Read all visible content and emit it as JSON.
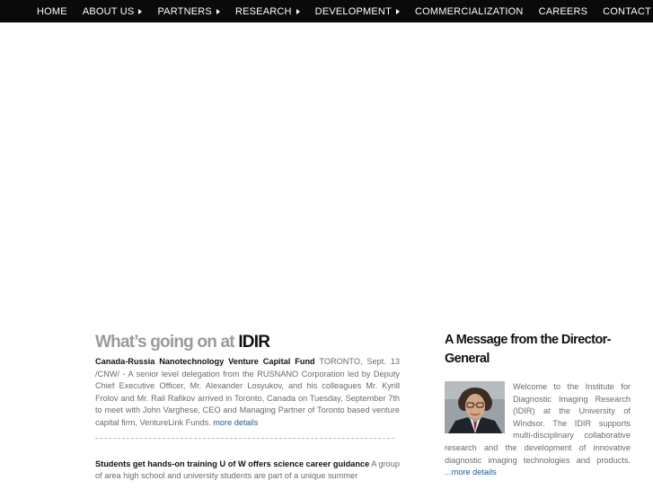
{
  "nav": {
    "items": [
      {
        "label": "HOME",
        "has_submenu": false
      },
      {
        "label": "ABOUT US",
        "has_submenu": true
      },
      {
        "label": "PARTNERS",
        "has_submenu": true
      },
      {
        "label": "RESEARCH",
        "has_submenu": true
      },
      {
        "label": "DEVELOPMENT",
        "has_submenu": true
      },
      {
        "label": "COMMERCIALIZATION",
        "has_submenu": false
      },
      {
        "label": "CAREERS",
        "has_submenu": false
      },
      {
        "label": "CONTACT US",
        "has_submenu": false
      }
    ]
  },
  "news": {
    "heading_prefix": "What’s going on at",
    "heading_brand": "IDIR",
    "items": [
      {
        "title": "Canada-Russia Nanotechnology Venture Capital Fund",
        "body": " TORONTO, Sept. 13 /CNW/ - A senior level delegation from the RUSNANO Corporation led by Deputy Chief Executive Officer, Mr. Alexander Losyukov, and his colleagues Mr. Kyrill Frolov and Mr. Rail Rafikov arrived in Toronto, Canada on Tuesday, September 7th to meet with John Varghese, CEO and Managing Partner of Toronto based venture capital firm, VentureLink Funds. ",
        "link": "more details"
      },
      {
        "title": "Students get hands-on training U of W offers science career guidance",
        "body": " A group of area high school and university students are part of a unique summer"
      }
    ]
  },
  "message": {
    "heading": "A Message from the Director-General",
    "body": "Welcome to the Institute for Diagnostic Imaging Research (IDIR) at the University of Windsor. The IDIR supports multi-disciplinary collaborative research and the development of innovative diagnostic imaging technologies and products. ...",
    "link": "more details"
  },
  "colors": {
    "nav_bg": "#0a0a0a",
    "heading_gray": "#9a9a9a",
    "link_blue": "#1c5a98",
    "body_text": "#6b6b6b"
  }
}
